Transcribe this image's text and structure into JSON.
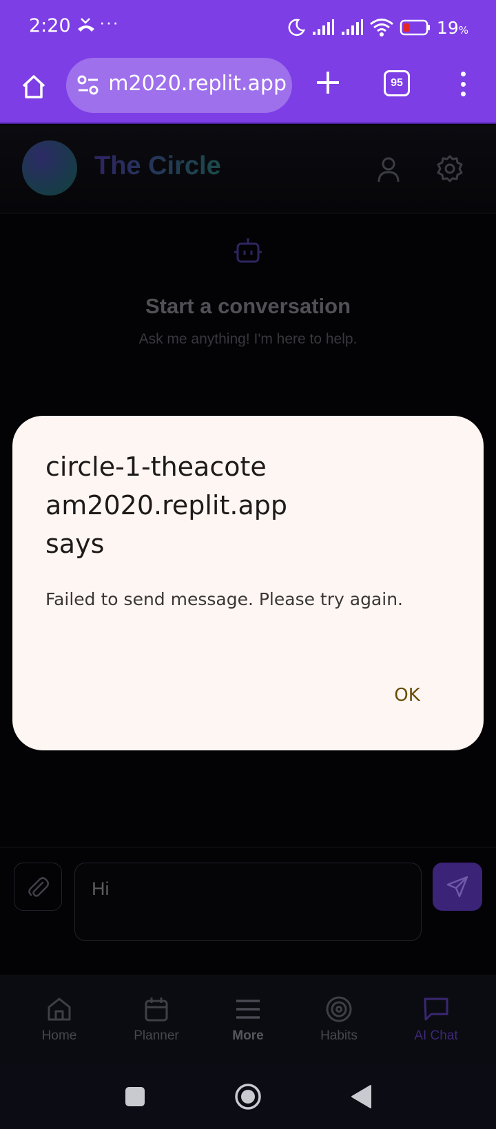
{
  "status_bar": {
    "time": "2:20",
    "more_indicator": "···",
    "battery_percent": "19",
    "battery_unit": "%"
  },
  "browser": {
    "url": "circle-1-theacoteam2020.replit.app",
    "url_visible": "m2020.replit.app",
    "tab_count": "95"
  },
  "app": {
    "title": "The Circle",
    "empty_state": {
      "title": "Start a conversation",
      "subtitle": "Ask me anything! I'm here to help."
    },
    "composer": {
      "input_value": "Hi"
    },
    "nav": [
      {
        "label": "Home",
        "icon": "home-icon"
      },
      {
        "label": "Planner",
        "icon": "calendar-icon"
      },
      {
        "label": "More",
        "icon": "menu-icon"
      },
      {
        "label": "Habits",
        "icon": "target-icon"
      },
      {
        "label": "AI Chat",
        "icon": "chat-icon",
        "active": true
      }
    ]
  },
  "dialog": {
    "title_lines": [
      "circle-1-theacote",
      "am2020.replit.app",
      "says"
    ],
    "message": "Failed to send message. Please try again.",
    "ok_label": "OK"
  },
  "colors": {
    "accent": "#7d3ee6",
    "dialog_bg": "#fdf6f2",
    "ok_text": "#6b4c06"
  }
}
